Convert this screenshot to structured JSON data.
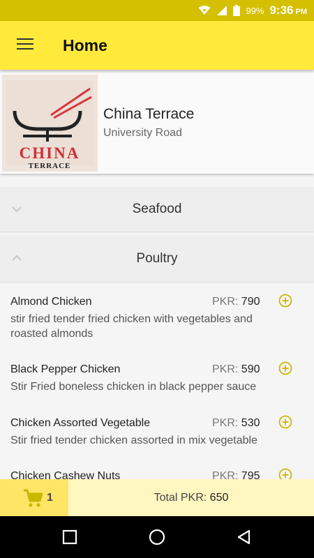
{
  "status_bar": {
    "battery": "99%",
    "time": "9:36",
    "ampm": "PM"
  },
  "app_bar": {
    "title": "Home"
  },
  "restaurant": {
    "name": "China Terrace",
    "area": "University Road",
    "logo_text_top": "CHINA",
    "logo_text_bottom": "TERRACE"
  },
  "categories": [
    {
      "label": "Seafood",
      "expanded": false
    },
    {
      "label": "Poultry",
      "expanded": true
    }
  ],
  "menu_items": [
    {
      "name": "Almond Chicken",
      "currency": "PKR:",
      "price": "790",
      "description": "stir fried tender fried chicken with vegetables and roasted almonds"
    },
    {
      "name": "Black Pepper Chicken",
      "currency": "PKR:",
      "price": "590",
      "description": "Stir Fried boneless chicken in black pepper sauce"
    },
    {
      "name": "Chicken Assorted Vegetable",
      "currency": "PKR:",
      "price": "530",
      "description": "Stir fried tender chicken assorted in mix vegetable"
    },
    {
      "name": "Chicken Cashew Nuts",
      "currency": "PKR:",
      "price": "795",
      "description": ""
    }
  ],
  "cart": {
    "count": "1",
    "total_label": "Total PKR:",
    "total_value": "650"
  },
  "colors": {
    "status_bar": "#d4c000",
    "app_bar": "#ffe93b",
    "accent": "#c9b800",
    "cart_box": "#ffe566",
    "total_bar": "#fff6c0"
  },
  "icons": {
    "menu": "hamburger-icon",
    "wifi": "wifi-icon",
    "signal": "signal-icon",
    "battery": "battery-icon",
    "collapse": "chevron-down-icon",
    "expand": "chevron-up-icon",
    "add": "add-circle-icon",
    "cart": "cart-icon",
    "nav_recents": "recents-icon",
    "nav_home": "home-icon",
    "nav_back": "back-icon"
  }
}
